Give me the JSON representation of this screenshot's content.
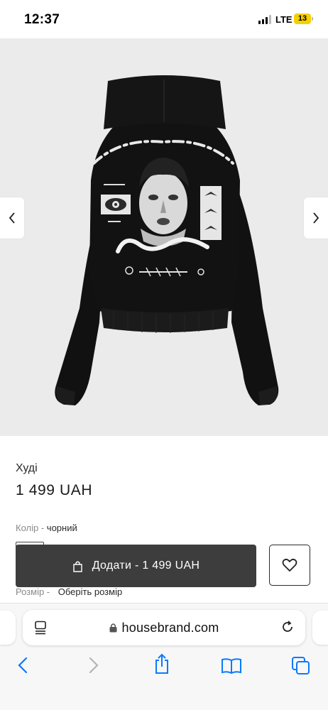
{
  "status_bar": {
    "time": "12:37",
    "network": "LTE",
    "battery": "13"
  },
  "product": {
    "title": "Худі",
    "price": "1 499 UAH",
    "color_label": "Колір -",
    "color_value": "чорний",
    "add_button": "Додати - 1 499 UAH",
    "size_label": "Розмір -",
    "size_value": "Оберіть розмір"
  },
  "browser": {
    "url": "housebrand.com"
  },
  "colors": {
    "button_bg": "#3d3d3d",
    "battery": "#f5d000",
    "ios_blue": "#0a7aff"
  },
  "icons": [
    "chevron-left-icon",
    "chevron-right-icon",
    "bag-icon",
    "heart-icon",
    "page-menu-icon",
    "lock-icon",
    "reload-icon",
    "back-icon",
    "forward-icon",
    "share-icon",
    "bookmarks-icon",
    "tabs-icon"
  ]
}
